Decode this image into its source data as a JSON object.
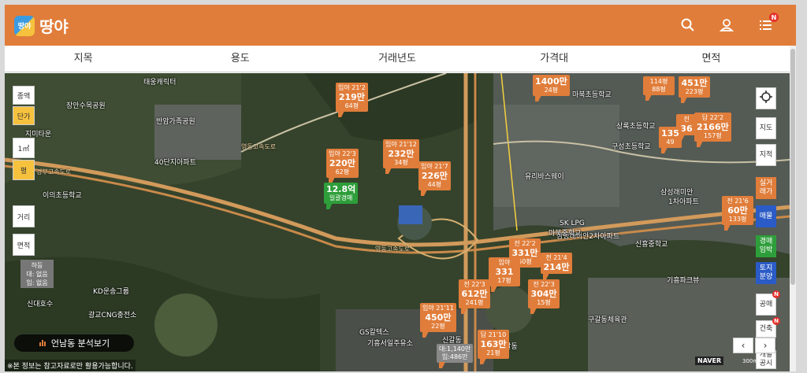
{
  "header": {
    "logo_mark": "땅야",
    "title": "땅야",
    "search_icon": "search-icon",
    "user_icon": "user-icon",
    "menu_icon": "menu-icon",
    "menu_badge": "N"
  },
  "filters": [
    "지목",
    "용도",
    "거래년도",
    "가격대",
    "면적"
  ],
  "left_tools": {
    "type": "종액",
    "unit_price": "단가",
    "sqm": "1㎡",
    "pyeong": "평",
    "distance": "거리",
    "area": "면적"
  },
  "area_box": {
    "line1": "하등",
    "line2": "대: 없음",
    "line3": "임: 없음"
  },
  "analysis_button": "언남동 분석보기",
  "notice": "※본 정보는 참고자료로만 활용가능합니다.",
  "right_tools": {
    "map": "지도",
    "cadastral": "지적",
    "real_trade": "실거래가",
    "listing": "매물",
    "auction": "경매임박",
    "land_dev": "토지분양",
    "public_auction": "공매",
    "building": "건축",
    "dev": "개발공시",
    "badge": "N"
  },
  "attribution": {
    "naver": "NAVER",
    "scale": "300m"
  },
  "map_labels": [
    "장안수목공원",
    "반암가족공원",
    "태웅캐릭터",
    "지미타운",
    "40단지아파트",
    "이의초등학교",
    "신대호수",
    "KD운송그룹",
    "광교CNG충전소",
    "GS칼텍스",
    "기흥서일주유소",
    "신갈동",
    "마북초등학교",
    "삼성래미안",
    "1차아파트",
    "삼성래미안2차아파트",
    "신흥중학교",
    "기흥파크뷰",
    "구성초등학교",
    "구갈동",
    "유리바스웨이",
    "마북중학교",
    "SK LPG",
    "상록초등학교",
    "구갈동체육관"
  ],
  "road_labels": [
    "영동고속도로",
    "영동고속도로",
    "경부고속도로"
  ],
  "markers": [
    {
      "label": "임야 21'2",
      "price": "219만",
      "size": "64평"
    },
    {
      "label": "임야 22'3",
      "price": "220만",
      "size": "62평"
    },
    {
      "label": "일괄경매",
      "price": "12.8억",
      "size": ""
    },
    {
      "label": "임야 21'12",
      "price": "232만",
      "size": "34평"
    },
    {
      "label": "임야 21'7",
      "price": "226만",
      "size": "44평"
    },
    {
      "label": "",
      "price": "1400만",
      "size": "24평"
    },
    {
      "label": "",
      "price": "451만",
      "size": "223평"
    },
    {
      "label": "114평",
      "price": "",
      "size": "88평"
    },
    {
      "label": "답 22'2",
      "price": "2166만",
      "size": "157평"
    },
    {
      "label": "전",
      "price": "36",
      "size": ""
    },
    {
      "label": "",
      "price": "135",
      "size": "49"
    },
    {
      "label": "전 21'6",
      "price": "60만",
      "size": "133평"
    },
    {
      "label": "전 22'2",
      "price": "331만",
      "size": "50평"
    },
    {
      "label": "전 21'4",
      "price": "214만",
      "size": ""
    },
    {
      "label": "임야",
      "price": "331",
      "size": "17평"
    },
    {
      "label": "전 22'3",
      "price": "612만",
      "size": "241평"
    },
    {
      "label": "전 22'3",
      "price": "304만",
      "size": "15평"
    },
    {
      "label": "임야 21'11",
      "price": "450만",
      "size": "22평"
    },
    {
      "label": "답 21'10",
      "price": "163만",
      "size": "21평"
    },
    {
      "label": "대:1,140만",
      "price": "",
      "size": "임:486만"
    }
  ]
}
